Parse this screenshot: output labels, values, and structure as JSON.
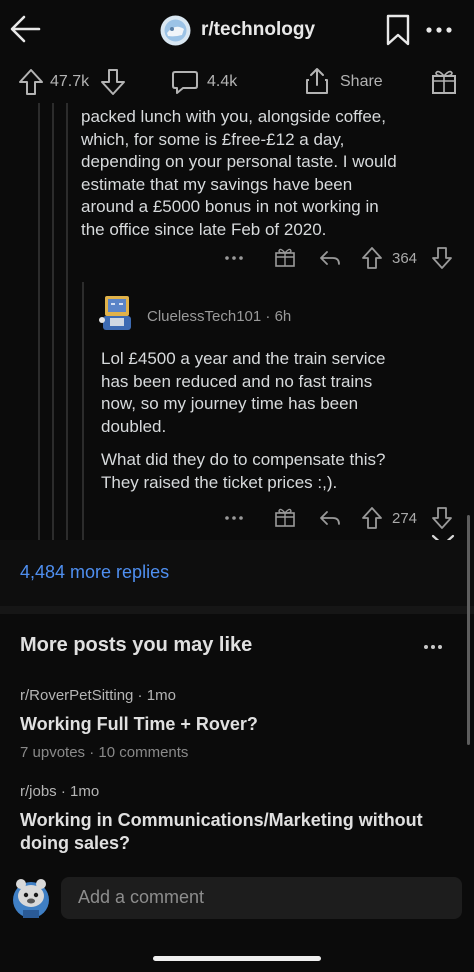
{
  "header": {
    "subreddit": "r/technology",
    "back_icon": "back-arrow-icon",
    "avatar_icon": "subreddit-avatar-icon",
    "bookmark_icon": "bookmark-icon",
    "more_icon": "more-dots-icon"
  },
  "post_actions": {
    "upvotes": "47.7k",
    "comments": "4.4k",
    "share_label": "Share"
  },
  "parent_comment": {
    "text_lines": [
      "packed lunch with you, alongside coffee,",
      "which, for some is £free-£12 a day,",
      "depending on your personal taste. I would",
      "estimate that my savings have been",
      "around a £5000 bonus in not working in",
      "the office since late Feb of 2020."
    ],
    "votes": "364"
  },
  "reply_comment": {
    "username": "CluelessTech101",
    "age": "6h",
    "para1_lines": [
      "Lol £4500 a year and the train service",
      "has been reduced and no fast trains",
      "now, so my journey time has been",
      "doubled."
    ],
    "para2_lines": [
      "What did they do to compensate this?",
      "They raised the ticket prices :,)."
    ],
    "votes": "274"
  },
  "more_replies": "4,484 more replies",
  "recommendations": {
    "title": "More posts you may like",
    "posts": [
      {
        "subreddit": "r/RoverPetSitting",
        "age": "1mo",
        "title": "Working Full Time + Rover?",
        "upvotes": "7 upvotes",
        "comments": "10 comments"
      },
      {
        "subreddit": "r/jobs",
        "age": "1mo",
        "title_lines": [
          "Working in Communications/Marketing without",
          "doing sales?"
        ]
      }
    ]
  },
  "comment_bar": {
    "placeholder": "Add a comment"
  },
  "colors": {
    "background": "#0b0b0b",
    "link": "#4f8ff0",
    "text": "#d7dadc"
  }
}
